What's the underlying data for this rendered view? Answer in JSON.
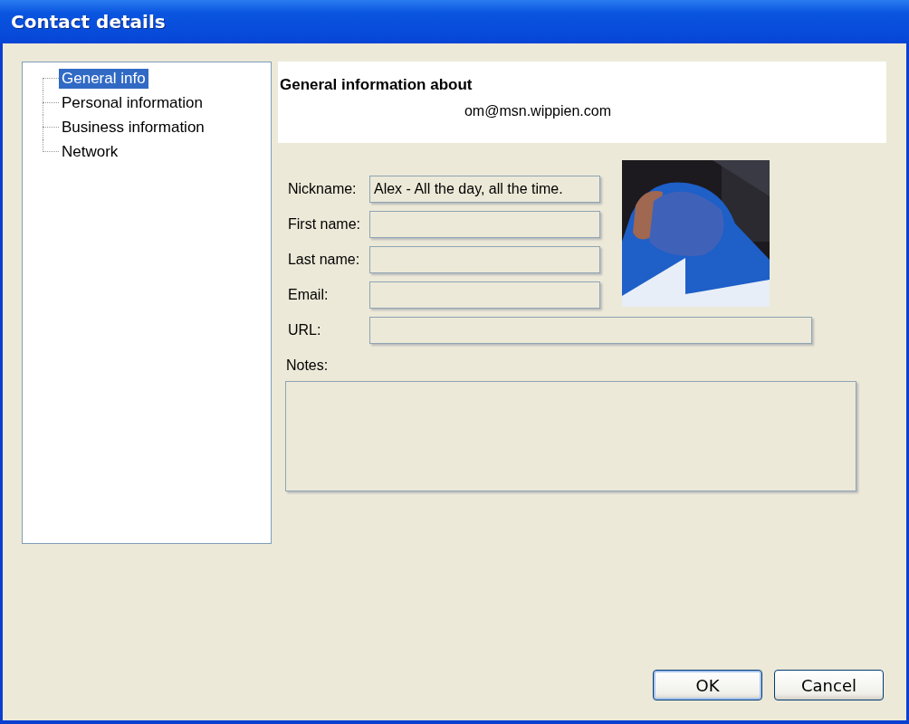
{
  "window": {
    "title": "Contact details"
  },
  "tree": {
    "items": [
      {
        "label": "General info",
        "selected": true
      },
      {
        "label": "Personal information",
        "selected": false
      },
      {
        "label": "Business information",
        "selected": false
      },
      {
        "label": "Network",
        "selected": false
      }
    ]
  },
  "header": {
    "title": "General information about",
    "subtitle": "om@msn.wippien.com"
  },
  "fields": [
    {
      "label": "Nickname:",
      "value": "Alex - All the day, all the time."
    },
    {
      "label": "First name:"
    },
    {
      "label": "Last name:"
    },
    {
      "label": "Email:"
    },
    {
      "label": "URL:",
      "wide": true
    }
  ],
  "notes": {
    "label": "Notes:"
  },
  "buttons": [
    {
      "label": "OK",
      "default": true
    },
    {
      "label": "Cancel",
      "default": false
    }
  ]
}
